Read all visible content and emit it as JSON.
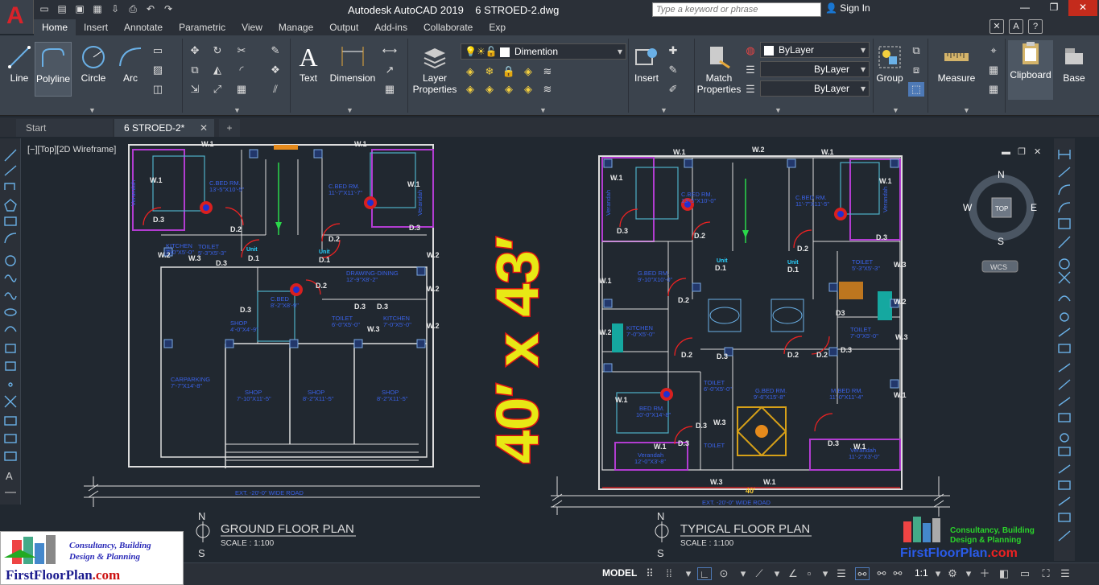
{
  "app": {
    "title": "Autodesk AutoCAD 2019",
    "document": "6 STROED-2.dwg",
    "search_placeholder": "Type a keyword or phrase",
    "sign_in": "Sign In"
  },
  "ribbon_tabs": [
    "Home",
    "Insert",
    "Annotate",
    "Parametric",
    "View",
    "Manage",
    "Output",
    "Add-ins",
    "Collaborate",
    "Exp"
  ],
  "ribbon": {
    "line": "Line",
    "polyline": "Polyline",
    "circle": "Circle",
    "arc": "Arc",
    "text": "Text",
    "dimension": "Dimension",
    "layer_properties_1": "Layer",
    "layer_properties_2": "Properties",
    "layer_current": "Dimention",
    "insert": "Insert",
    "match_properties_1": "Match",
    "match_properties_2": "Properties",
    "bylayer_color": "ByLayer",
    "bylayer_linetype": "ByLayer",
    "bylayer_lineweight": "ByLayer",
    "group": "Group",
    "measure": "Measure",
    "clipboard": "Clipboard",
    "base": "Base"
  },
  "file_tabs": {
    "start": "Start",
    "drawing": "6 STROED-2*",
    "add": "+"
  },
  "viewport_label": "[−][Top][2D Wireframe]",
  "drawing": {
    "headline": "40′ x 43′",
    "ground_title": "GROUND FLOOR PLAN",
    "ground_scale": "SCALE : 1:100",
    "typical_title": "TYPICAL FLOOR PLAN",
    "typical_scale": "SCALE : 1:100",
    "north": "N",
    "south": "S",
    "road_label": "EXT. -20'-0\"  WIDE  ROAD",
    "dim_40": "40'",
    "ground_rooms": [
      {
        "name": "C.BED RM.",
        "size": "13'-5\"X10'-5\""
      },
      {
        "name": "C.BED RM.",
        "size": "11'-7\"X11'-7\""
      },
      {
        "name": "KITCHEN",
        "size": "7'-0\"X5'-0\""
      },
      {
        "name": "TOILET",
        "size": "5'-3\"X5'-3\""
      },
      {
        "name": "DRAWING-DINING",
        "size": "12'-9\"X8'-2\""
      },
      {
        "name": "C.BED",
        "size": "8'-2\"X8'-9\""
      },
      {
        "name": "SHOP",
        "size": "4'-0\"X4'-9\""
      },
      {
        "name": "TOILET",
        "size": "6'-0\"X5'-0\""
      },
      {
        "name": "KITCHEN",
        "size": "7'-0\"X5'-0\""
      },
      {
        "name": "CARPARKING",
        "size": "7'-7\"X14'-8\""
      },
      {
        "name": "SHOP",
        "size": "7'-10\"X11'-5\""
      },
      {
        "name": "SHOP",
        "size": "8'-2\"X11'-5\""
      },
      {
        "name": "SHOP",
        "size": "8'-2\"X11'-5\""
      }
    ],
    "typical_rooms": [
      {
        "name": "C.BED RM.",
        "size": "13'-5\"X10'-0\""
      },
      {
        "name": "C.BED RM.",
        "size": "11'-7\"X11'-5\""
      },
      {
        "name": "G.BED RM.",
        "size": "9'-10\"X10'-0\""
      },
      {
        "name": "TOILET",
        "size": "5'-3\"X5'-3\""
      },
      {
        "name": "KITCHEN",
        "size": "7'-0\"X5'-0\""
      },
      {
        "name": "TOILET",
        "size": "7'-0\"X5'-0\""
      },
      {
        "name": "G.BED RM.",
        "size": "9'-6\"X15'-8\""
      },
      {
        "name": "M.BED RM.",
        "size": "11'-0\"X11'-4\""
      },
      {
        "name": "BED RM.",
        "size": "10'-0\"X14'-8\""
      },
      {
        "name": "TOILET",
        "size": "6'-0\"X5'-0\""
      },
      {
        "name": "Verandah",
        "size": "12'-0\"X3'-8\""
      },
      {
        "name": "Verandah",
        "size": "11'-2\"X3'-0\""
      }
    ],
    "tags": [
      "W.1",
      "W.2",
      "W.3",
      "D.1",
      "D.2",
      "D.3",
      "Unit",
      "Verandah"
    ]
  },
  "viewcube": {
    "top": "TOP",
    "n": "N",
    "s": "S",
    "e": "E",
    "w": "W",
    "wcs": "WCS"
  },
  "status": {
    "model": "MODEL",
    "scale": "1:1"
  },
  "branding": {
    "line1": "Consultancy, Building",
    "line2": "Design & Planning",
    "site": "FirstFloorPlan",
    "tld": ".com"
  }
}
